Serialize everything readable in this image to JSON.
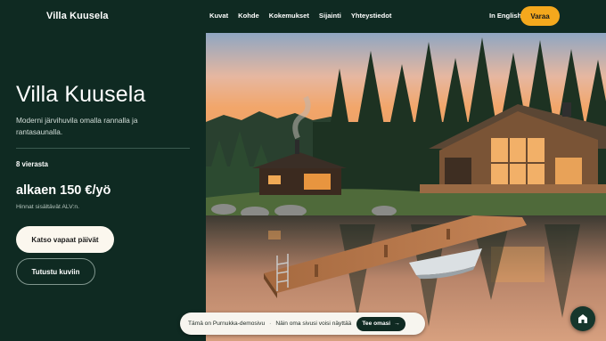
{
  "header": {
    "logo": "Villa Kuusela",
    "nav": [
      "Kuvat",
      "Kohde",
      "Kokemukset",
      "Sijainti",
      "Yhteystiedot"
    ],
    "language": "In English",
    "book_label": "Varaa"
  },
  "hero": {
    "title": "Villa Kuusela",
    "subtitle": "Moderni järvihuvila omalla rannalla ja rantasaunalla.",
    "guests": "8 vierasta",
    "price": "alkaen 150 €/yö",
    "vat_note": "Hinnat sisältävät ALV:n.",
    "primary_button": "Katso vapaat päivät",
    "secondary_button": "Tutustu kuviin"
  },
  "demo_bar": {
    "text_1": "Tämä on Purnukka-demosivu",
    "separator": "·",
    "text_2": "Näin oma sivusi voisi näyttää",
    "cta": "Tee omasi",
    "cta_arrow": "→"
  },
  "icons": {
    "fab": "home-icon",
    "arrow": "arrow-right-icon"
  },
  "colors": {
    "background": "#0f2a22",
    "accent": "#f4a81d",
    "button_light": "#fbf7ee"
  }
}
